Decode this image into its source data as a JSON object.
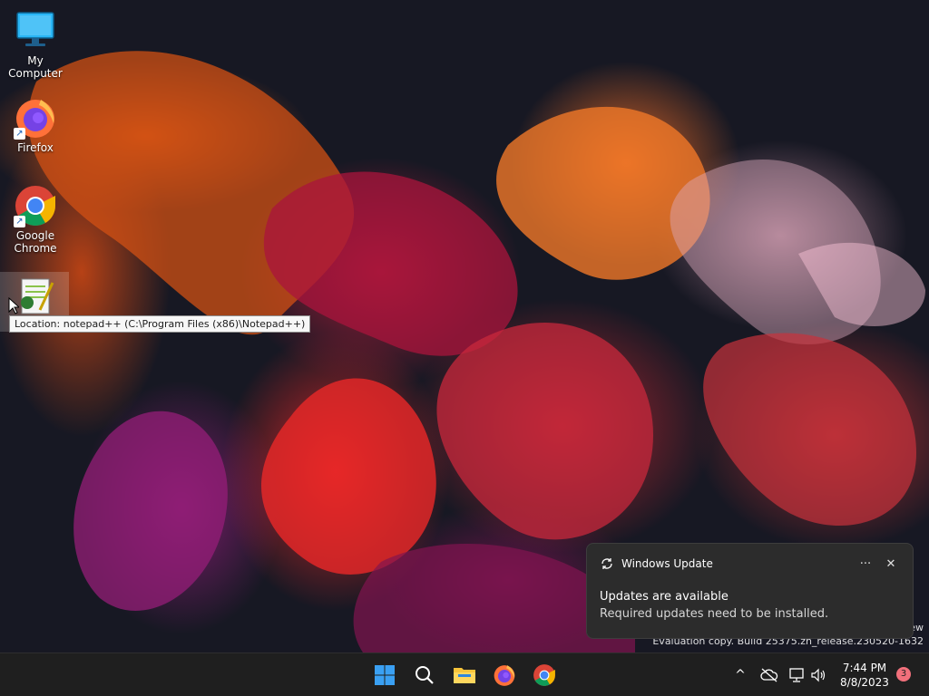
{
  "desktop": {
    "icons": [
      {
        "label": "My Computer",
        "icon": "computer-icon"
      },
      {
        "label": "Firefox",
        "icon": "firefox-icon"
      },
      {
        "label": "Google Chrome",
        "icon": "chrome-icon"
      },
      {
        "label": "",
        "icon": "notepad-plus-plus-icon"
      }
    ],
    "tooltip": "Location: notepad++ (C:\\Program Files (x86)\\Notepad++)"
  },
  "watermark": {
    "line1": "ew",
    "line2": "Evaluation copy. Build 25375.zn_release.230520-1632"
  },
  "notification": {
    "app_name": "Windows Update",
    "title": "Updates are available",
    "body": "Required updates need to be installed.",
    "more_label": "···",
    "close_label": "✕"
  },
  "taskbar": {
    "apps": [
      "start-icon",
      "search-icon",
      "file-explorer-icon",
      "firefox-icon",
      "chrome-icon"
    ],
    "tray": [
      "chevron-up-icon",
      "cloud-off-icon",
      "network-icon",
      "volume-icon"
    ],
    "tray_chevron": "^",
    "time": "7:44 PM",
    "date": "8/8/2023",
    "notification_count": "3"
  },
  "colors": {
    "taskbar": "#1f1f1f",
    "toast": "#2c2c2c",
    "badge": "#f1707b",
    "windows_blue": "#0078d4"
  }
}
